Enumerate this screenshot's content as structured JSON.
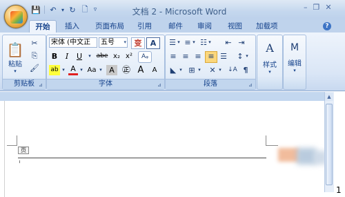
{
  "title_bar": {
    "document_title": "文档 2 - Microsoft Word",
    "qat": {
      "save": "💾",
      "undo": "↶",
      "undo_drop": "▾",
      "redo": "↻",
      "print": "🗋",
      "customize": "▿"
    },
    "controls": {
      "minimize": "–",
      "restore": "❐",
      "close": "✕"
    }
  },
  "tabs": [
    "开始",
    "插入",
    "页面布局",
    "引用",
    "邮件",
    "审阅",
    "视图",
    "加载项"
  ],
  "help": "?",
  "clipboard": {
    "label": "剪贴板",
    "paste": "粘贴",
    "paste_arrow": "▾",
    "cut": "✂",
    "copy": "⎘",
    "format_painter": "🖌",
    "launcher": "⊿"
  },
  "font": {
    "label": "字体",
    "font_name": "宋体 (中文正文)",
    "font_size": "五号",
    "buttons": {
      "phonetic": "变",
      "char_border": "A",
      "bold": "B",
      "italic": "I",
      "underline": "U",
      "strike": "abe",
      "subscript": "x₂",
      "superscript": "x²",
      "clear": "Aᵩ",
      "highlight": "ab",
      "font_color": "A",
      "change_case": "Aa",
      "shading": "A",
      "enclose": "㊣",
      "grow": "A",
      "shrink": "A"
    },
    "launcher": "⊿"
  },
  "paragraph": {
    "label": "段落",
    "bullets": "☰",
    "numbering": "≡",
    "multilevel": "☷",
    "dec_indent": "⇤",
    "inc_indent": "⇥",
    "align_left": "≡",
    "center": "≡",
    "align_right": "≡",
    "justify": "≡",
    "distributed": "☰",
    "line_spacing": "↕",
    "shading": "◣",
    "borders": "⊞",
    "chinese_layout": "✕",
    "sort": "↓A",
    "show_marks": "¶",
    "launcher": "⊿"
  },
  "styles": {
    "label": "样式",
    "icon": "A",
    "arrow": "▾"
  },
  "editing": {
    "label": "编辑",
    "icon": "M",
    "arrow": "▾"
  },
  "document": {
    "header_tag": "页",
    "page_number": "1"
  },
  "scrollbar": {
    "up": "▲"
  },
  "colors": {
    "ribbon_text": "#15428b",
    "title_bg": "#c4d7ee",
    "tab_active_bg": "#eef4fc"
  }
}
